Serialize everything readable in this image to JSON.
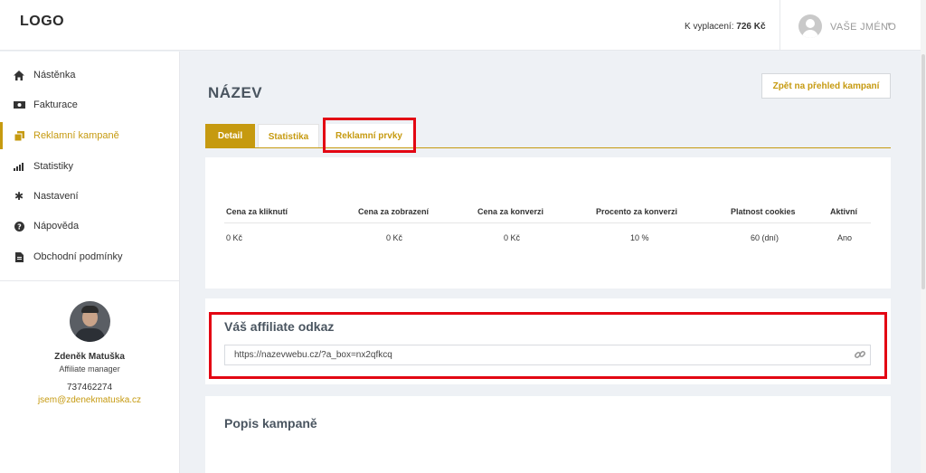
{
  "header": {
    "logo": "LOGO",
    "payout_label": "K vyplacení:",
    "payout_value": "726 Kč",
    "user_name": "VAŠE JMÉNO"
  },
  "sidebar": {
    "items": [
      {
        "label": "Nástěnka",
        "icon": "home-icon"
      },
      {
        "label": "Fakturace",
        "icon": "money-icon"
      },
      {
        "label": "Reklamní kampaně",
        "icon": "copy-icon",
        "active": true
      },
      {
        "label": "Statistiky",
        "icon": "signal-bars-icon"
      },
      {
        "label": "Nastavení",
        "icon": "gear-icon"
      },
      {
        "label": "Nápověda",
        "icon": "question-circle-icon"
      },
      {
        "label": "Obchodní podmínky",
        "icon": "document-icon"
      }
    ],
    "manager": {
      "name": "Zdeněk Matuška",
      "role": "Affiliate manager",
      "phone": "737462274",
      "email": "jsem@zdenekmatuska.cz"
    }
  },
  "main": {
    "title": "NÁZEV",
    "back_button": "Zpět na přehled kampaní",
    "tabs": [
      "Detail",
      "Statistika",
      "Reklamní prvky"
    ],
    "active_tab": "Detail",
    "table": {
      "headers": [
        "Cena za kliknutí",
        "Cena za zobrazení",
        "Cena za konverzi",
        "Procento za konverzi",
        "Platnost cookies",
        "Aktivní"
      ],
      "row": [
        "0 Kč",
        "0 Kč",
        "0 Kč",
        "10 %",
        "60 (dní)",
        "Ano"
      ]
    },
    "affiliate": {
      "title": "Váš affiliate odkaz",
      "url": "https://nazevwebu.cz/?a_box=nx2qfkcq"
    },
    "description_title": "Popis kampaně"
  },
  "colors": {
    "accent": "#c69a10",
    "highlight": "#e30613",
    "heading": "#4a5560"
  }
}
